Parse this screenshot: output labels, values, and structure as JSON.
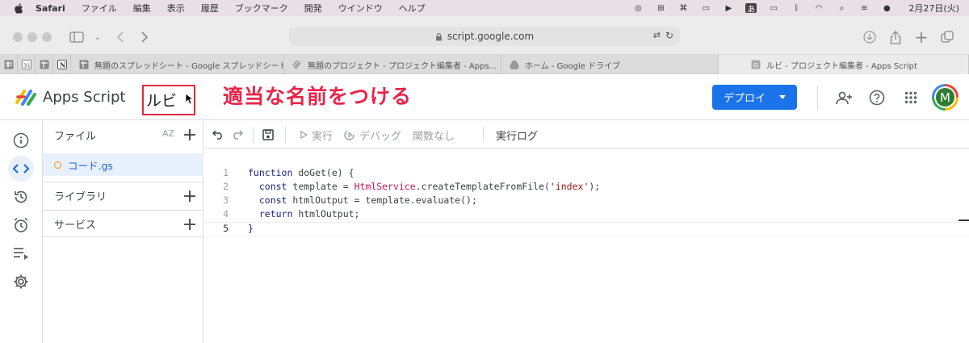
{
  "menubar": {
    "app": "Safari",
    "items": [
      "ファイル",
      "編集",
      "表示",
      "履歴",
      "ブックマーク",
      "開発",
      "ウインドウ",
      "ヘルプ"
    ],
    "ime": "あ",
    "clock": "2月27日(火)"
  },
  "browser": {
    "url": "script.google.com",
    "tabs": [
      {
        "label": "無題のスプレッドシート - Google スプレッドシート"
      },
      {
        "label": "無題のプロジェクト - プロジェクト編集者 - Apps..."
      },
      {
        "label": "ホーム - Google ドライブ"
      },
      {
        "label": "ルビ - プロジェクト編集者 - Apps Script"
      }
    ]
  },
  "header": {
    "app_name": "Apps Script",
    "project_name": "ルビ",
    "annotation": "適当な名前をつける",
    "deploy_label": "デプロイ",
    "avatar_letter": "M"
  },
  "files_panel": {
    "files_title": "ファイル",
    "sort_label": "AZ",
    "file_name": "コード.gs",
    "libraries_title": "ライブラリ",
    "services_title": "サービス"
  },
  "editor_toolbar": {
    "run": "実行",
    "debug": "デバッグ",
    "no_function": "関数なし",
    "exec_log": "実行ログ"
  },
  "code": {
    "line_numbers": [
      "1",
      "2",
      "3",
      "4",
      "5"
    ],
    "l1": {
      "kw": "function",
      "rest": " doGet(e) {"
    },
    "l2": {
      "kw": "  const",
      "a": " template = ",
      "cls": "HtmlService",
      "b": ".createTemplateFromFile(",
      "str": "'index'",
      "c": ");"
    },
    "l3": {
      "kw": "  const",
      "rest": " htmlOutput = template.evaluate();"
    },
    "l4": {
      "kw": "  return",
      "rest": " htmlOutput;"
    },
    "l5": {
      "rest": "}"
    }
  },
  "colors": {
    "accent": "#1a73e8",
    "annotation": "#e8254a",
    "selected_bg": "#e8f0fe"
  }
}
